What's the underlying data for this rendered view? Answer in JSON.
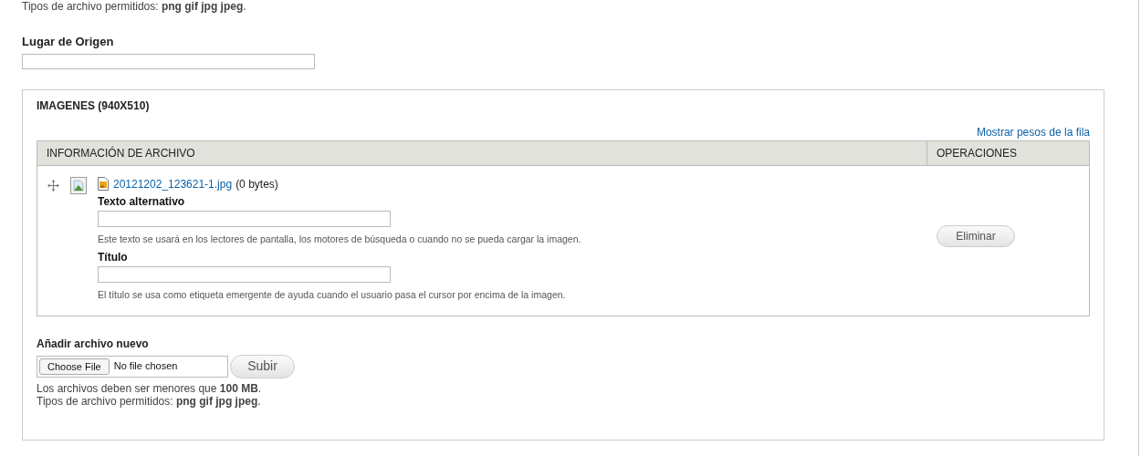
{
  "top_help": "Tipos de archivo permitidos: **png gif jpg jpeg**.",
  "origin_field": {
    "label": "Lugar de Origen"
  },
  "images": {
    "title": "IMAGENES (940X510)",
    "weights_link": "Mostrar pesos de la fila",
    "columns": [
      "INFORMACIÓN DE ARCHIVO",
      "OPERACIONES"
    ],
    "rows": [
      {
        "file_link": "20121202_123621-1.jpg",
        "size": "(0 bytes)",
        "alt_label": "Texto alternativo",
        "alt_help": "Este texto se usará en los lectores de pantalla, los motores de búsqueda o cuando no se pueda cargar la imagen.",
        "title_label": "Título",
        "title_help": "El título se usa como etiqueta emergente de ayuda cuando el usuario pasa el cursor por encima de la imagen.",
        "remove_button": "Eliminar"
      }
    ],
    "add": {
      "label": "Añadir archivo nuevo",
      "choose_button": "Choose File",
      "file_status": "No file chosen",
      "upload_button": "Subir",
      "help": [
        "Los archivos deben ser menores que **100 MB**.",
        "Tipos de archivo permitidos: **png gif jpg jpeg**."
      ]
    }
  }
}
